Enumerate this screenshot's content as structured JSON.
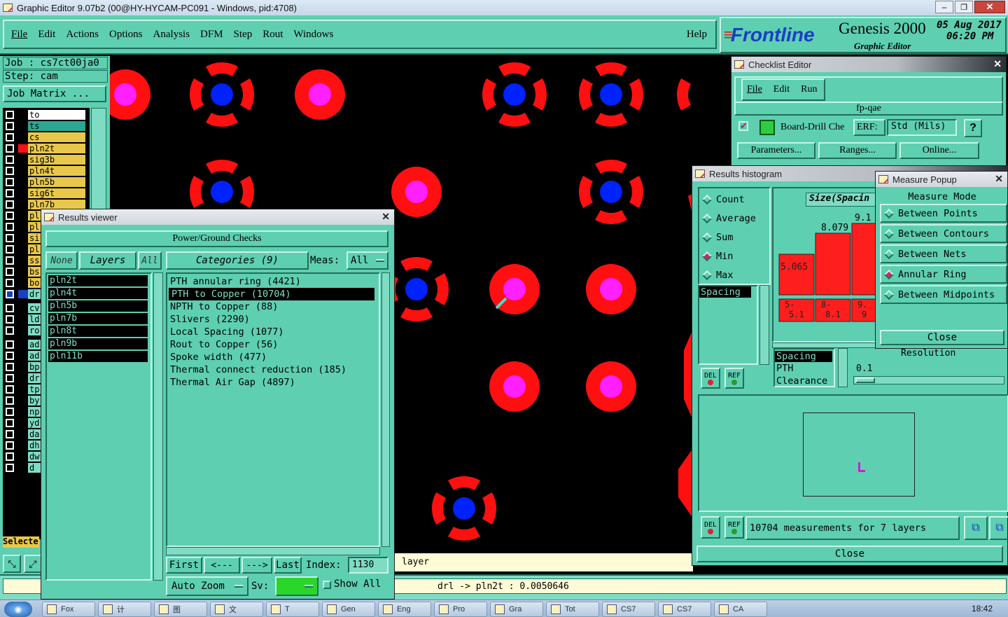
{
  "window": {
    "title": "Graphic Editor 9.07b2 (00@HY-HYCAM-PC091 - Windows, pid:4708)"
  },
  "menu": {
    "items": [
      "File",
      "Edit",
      "Actions",
      "Options",
      "Analysis",
      "DFM",
      "Step",
      "Rout",
      "Windows"
    ],
    "help": "Help"
  },
  "brand": {
    "logo": "Frontline",
    "product": "Genesis 2000",
    "subtitle": "Graphic Editor",
    "date": "05 Aug 2017",
    "time": "06:20 PM"
  },
  "job": {
    "job_label": "Job : cs7ct00ja0",
    "step_label": "Step: cam",
    "matrix_button": "Job Matrix ..."
  },
  "layers": [
    "to",
    "ts",
    "cs",
    "pln2t",
    "sig3b",
    "pln4t",
    "pln5b",
    "sig6t",
    "pln7b",
    "pl",
    "pl",
    "si",
    "pl",
    "ss",
    "bs",
    "bo",
    "dr",
    "cv",
    "ld",
    "ro",
    "ad",
    "ad",
    "bp",
    "dr",
    "tp",
    "by",
    "np",
    "yd",
    "da",
    "dh",
    "dw",
    "d"
  ],
  "left": {
    "selected_label": "Selecte"
  },
  "results_viewer": {
    "title": "Results viewer",
    "header": "Power/Ground Checks",
    "none": "None",
    "layers_label": "Layers",
    "all": "All",
    "categories_label": "Categories (9)",
    "meas_label": "Meas:",
    "meas_value": "All",
    "layer_list": [
      "pln2t",
      "pln4t",
      "pln5b",
      "pln7b",
      "pln8t",
      "pln9b",
      "pln11b"
    ],
    "categories": [
      "PTH annular ring (4421)",
      "PTH to Copper (10704)",
      "NPTH to Copper (88)",
      "Slivers (2290)",
      "Local Spacing (1077)",
      "Rout to Copper (56)",
      "Spoke width (477)",
      "Thermal connect reduction (185)",
      "Thermal Air Gap (4897)"
    ],
    "selected_category": "PTH to Copper (10704)",
    "first": "First",
    "prev": "<---",
    "next": "--->",
    "last": "Last",
    "index_label": "Index:",
    "index_value": "1130",
    "auto_zoom": "Auto Zoom",
    "sv_label": "Sv:",
    "show_all": "Show All"
  },
  "status": {
    "layer_hint": "layer",
    "measure": "drl -> pln2t : 0.0050646"
  },
  "checklist": {
    "title": "Checklist Editor",
    "menu": [
      "File",
      "Edit",
      "Run"
    ],
    "name": "fp-qae",
    "item": "Board-Drill Che",
    "erf_label": "ERF:",
    "erf_value": "Std (Mils)",
    "help": "?",
    "parameters": "Parameters...",
    "ranges": "Ranges...",
    "online": "Online..."
  },
  "histogram": {
    "title": "Results histogram",
    "options": [
      "Count",
      "Average",
      "Sum",
      "Min",
      "Max"
    ],
    "selected_option": "Min",
    "size_label": "Size(Spacin",
    "list_a": [
      "Spacing"
    ],
    "list_b": [
      "Spacing",
      "PTH",
      "Clearance"
    ],
    "resolution_label": "Resolution",
    "resolution_value": "0.1",
    "del": "DEL",
    "ref": "REF",
    "summary": "10704 measurements for 7 layers",
    "close": "Close"
  },
  "chart_data": {
    "type": "bar",
    "categories": [
      "5-5.1",
      "8-8.1",
      "9.-9"
    ],
    "values": [
      5.065,
      8.079,
      9.1
    ],
    "data_labels": [
      "5.065",
      "8.079",
      "9.1"
    ],
    "tick_labels": [
      [
        "5-",
        "5.1"
      ],
      [
        "8-",
        "8.1"
      ],
      [
        "9.",
        "9"
      ]
    ],
    "color": "#ff1e1e"
  },
  "measure": {
    "title": "Measure Popup",
    "mode_label": "Measure Mode",
    "modes": [
      "Between Points",
      "Between Contours",
      "Between Nets",
      "Annular Ring",
      "Between Midpoints"
    ],
    "selected": "Annular Ring",
    "close": "Close"
  },
  "taskbar": {
    "items": [
      "Fox",
      "计",
      "图",
      "文",
      "T",
      "Gen",
      "Eng",
      "Pro",
      "Gra",
      "Tot",
      "CS7",
      "CS7",
      "CA"
    ],
    "clock": "18:42"
  },
  "colors": {
    "panel": "#5ecfb1",
    "pad": "#ff1010",
    "via": "#0022ff",
    "drill": "#ff20ff"
  }
}
